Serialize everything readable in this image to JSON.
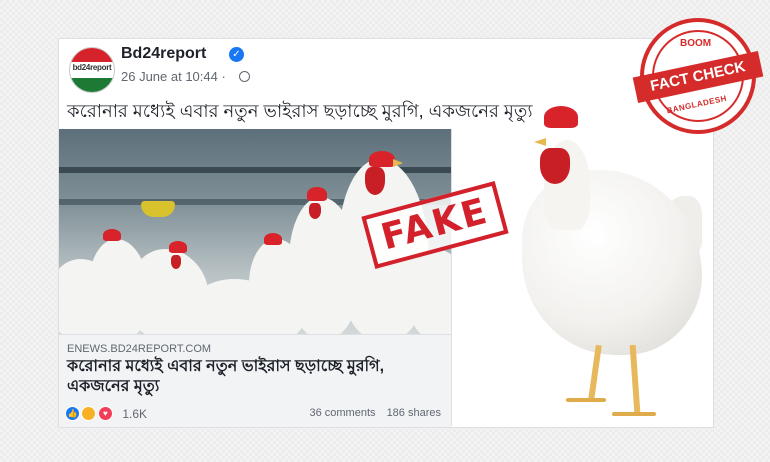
{
  "post": {
    "page_name": "Bd24report",
    "date": "26 June at 10:44",
    "separator": "·",
    "avatar_logo": "bd24report",
    "text": "করোনার মধ্যেই এবার নতুন ভাইরাস ছড়াচ্ছে মুরগি, একজনের মৃত্যু"
  },
  "link_card": {
    "domain": "ENEWS.BD24REPORT.COM",
    "title": "করোনার মধ্যেই এবার নতুন ভাইরাস ছড়াচ্ছে মুরগি, একজনের মৃত্যু"
  },
  "engagement": {
    "reaction_count": "1.6K",
    "comments": "36 comments",
    "shares": "186 shares"
  },
  "overlays": {
    "fake_stamp": "FAKE",
    "fact_check_top": "BOOM",
    "fact_check_banner": "FACT CHECK",
    "fact_check_bottom": "BANGLADESH"
  },
  "colors": {
    "stamp_red": "#d3212b",
    "facebook_blue": "#1877f2"
  },
  "icons": [
    "verified-badge-icon",
    "globe-icon",
    "like-reaction-icon",
    "sad-reaction-icon",
    "love-reaction-icon"
  ]
}
